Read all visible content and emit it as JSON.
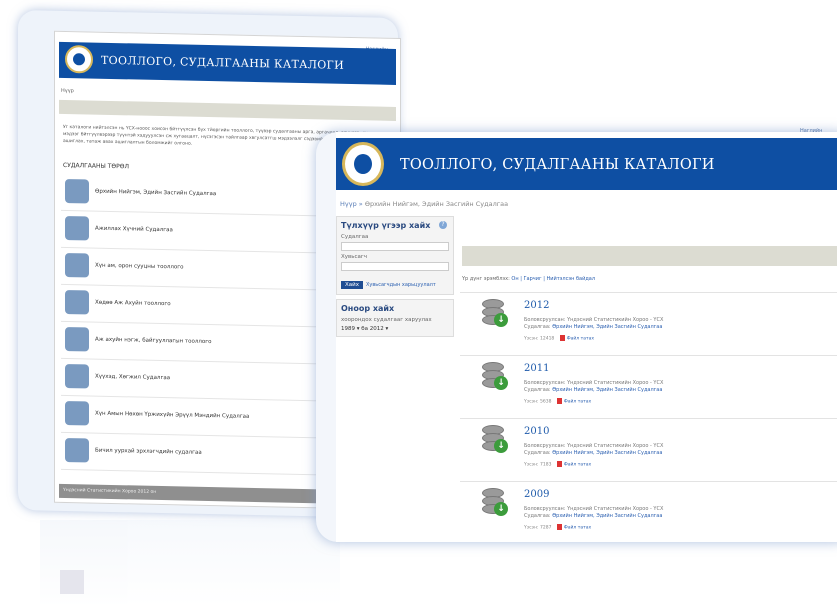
{
  "back_page": {
    "lang_link": "Наглийн",
    "header_title": "ТООЛЛОГО, СУДАЛГААНЫ КАТАЛОГИ",
    "breadcrumb": "Нүүр",
    "intro": "Уг каталоги нийтэлсэн нь ҮСХ-нооос хоисон бйтгүүлсэн бүх тйоргийн тооллого, түүвэр судалгааны арга, аргачлал, асуулга, судлан мэдээг бйтгүүлвэрээр түүнтэй хэдууулсэн сж хугаацалт, нүсэгэсэн тайлгаар хвгулсатгш мэдээлэлг сэдэвийг. Нжбүнзэр сортлуулж ашиглах, татаж авах ашиглалтын боломжийг олгоно.",
    "section_title": "СУДАЛГААНЫ ТӨРӨЛ",
    "items": [
      {
        "label": "Өрхийн Нийгэм, Эдийн Засгийн Судалгаа",
        "icon": "house-family-icon"
      },
      {
        "label": "Ажиллах Хүчний Судалгаа",
        "icon": "workforce-icon"
      },
      {
        "label": "Хүн ам, орон сууцны тооллого",
        "icon": "population-icon"
      },
      {
        "label": "Хөдөө Аж Ахуйн тооллого",
        "icon": "livestock-icon"
      },
      {
        "label": "Аж ахуйн нэгж, байгууллагын тооллого",
        "icon": "enterprise-icon"
      },
      {
        "label": "Хүүхэд, Хөгжил Судалгаа",
        "icon": "child-icon"
      },
      {
        "label": "Хүн Амын Нөхөн Үржихүйн Эрүүл Мэндийн Судалгаа",
        "icon": "health-icon"
      },
      {
        "label": "Бичил уурхай эрхлэгчдийн судалгаа",
        "icon": "miner-icon"
      }
    ],
    "footer": "Үндэсний Статистикийн Хороо 2012 он"
  },
  "front_page": {
    "lang_link": "Наглийн",
    "header_title": "ТООЛЛОГО, СУДАЛГААНЫ КАТАЛОГИ",
    "breadcrumb_home": "Нүүр",
    "breadcrumb_sep": " » ",
    "breadcrumb_current": "Өрхийн Нийгэм, Эдийн Засгийн Судалгаа",
    "search": {
      "title": "Түлхүүр үгээр хайх",
      "help": "?",
      "field1_label": "Судалгаа",
      "field2_label": "Хувьсагч",
      "button": "Хайх",
      "advanced": "Хувьсагчдын харьцуулалт"
    },
    "year_filter": {
      "title": "Оноор хайх",
      "subtitle": "хоорондох судалгааг харуулах",
      "from": "1989",
      "to_label": "бa",
      "to": "2012"
    },
    "sort_label": "Үр дүнг эрэмблэх:",
    "sort_options": "Он | Гарчиг",
    "sort_extra": "| Нийтэлсэн байдал",
    "entries": [
      {
        "year": "2012",
        "by": "Боловсруулсан: Үндэсний Статистикийн Хороо - ҮСХ",
        "cat_prefix": "Судалгаа:",
        "cat": "Өрхийн Нийгэм, Эдийн Засгийн Судалгаа",
        "views": "Үзсэн: 12418",
        "download": "Файл татах"
      },
      {
        "year": "2011",
        "by": "Боловсруулсан: Үндэсний Статистикийн Хороо - ҮСХ",
        "cat_prefix": "Судалгаа:",
        "cat": "Өрхийн Нийгэм, Эдийн Засгийн Судалгаа",
        "views": "Үзсэн: 5638",
        "download": "Файл татах"
      },
      {
        "year": "2010",
        "by": "Боловсруулсан: Үндэсний Статистикийн Хороо - ҮСХ",
        "cat_prefix": "Судалгаа:",
        "cat": "Өрхийн Нийгэм, Эдийн Засгийн Судалгаа",
        "views": "Үзсэн: 7183",
        "download": "Файл татах"
      },
      {
        "year": "2009",
        "by": "Боловсруулсан: Үндэсний Статистикийн Хороо - ҮСХ",
        "cat_prefix": "Судалгаа:",
        "cat": "Өрхийн Нийгэм, Эдийн Засгийн Судалгаа",
        "views": "Үзсэн: 7287",
        "download": "Файл татах"
      }
    ]
  },
  "colors": {
    "header_blue": "#0e4fa3",
    "link_blue": "#2a5fb0",
    "accent_gold": "#d7b75a",
    "download_green": "#3c9c3c"
  }
}
